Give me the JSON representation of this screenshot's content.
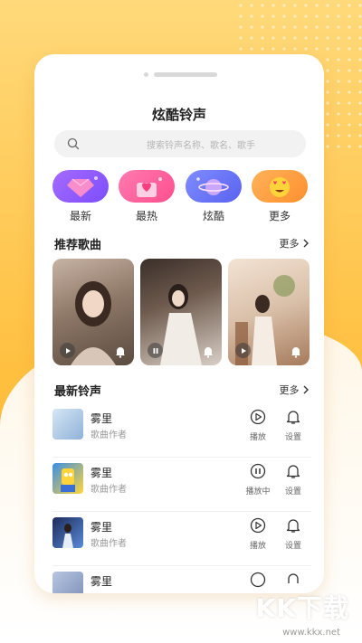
{
  "app": {
    "title": "炫酷铃声"
  },
  "search": {
    "placeholder": "搜索铃声名称、歌名、歌手"
  },
  "categories": [
    {
      "label": "最新",
      "icon": "diamond-icon"
    },
    {
      "label": "最热",
      "icon": "heart-box-icon"
    },
    {
      "label": "炫酷",
      "icon": "planet-icon"
    },
    {
      "label": "更多",
      "icon": "heart-eyes-emoji-icon"
    }
  ],
  "recommended": {
    "title": "推荐歌曲",
    "more_label": "更多",
    "cards": [
      {
        "state": "play",
        "icon": "play-icon"
      },
      {
        "state": "pause",
        "icon": "pause-icon"
      },
      {
        "state": "play",
        "icon": "play-icon"
      }
    ]
  },
  "latest": {
    "title": "最新铃声",
    "more_label": "更多",
    "items": [
      {
        "name": "雾里",
        "artist": "歌曲作者",
        "play_label": "播放",
        "set_label": "设置"
      },
      {
        "name": "雾里",
        "artist": "歌曲作者",
        "play_label": "播放中",
        "set_label": "设置"
      },
      {
        "name": "雾里",
        "artist": "歌曲作者",
        "play_label": "播放",
        "set_label": "设置"
      },
      {
        "name": "雾里",
        "artist": "",
        "play_label": "",
        "set_label": ""
      }
    ]
  },
  "watermark": {
    "brand": "KK下载",
    "url": "www.kkx.net"
  },
  "colors": {
    "background": "#ffc24a",
    "accent_dark": "#333333"
  }
}
